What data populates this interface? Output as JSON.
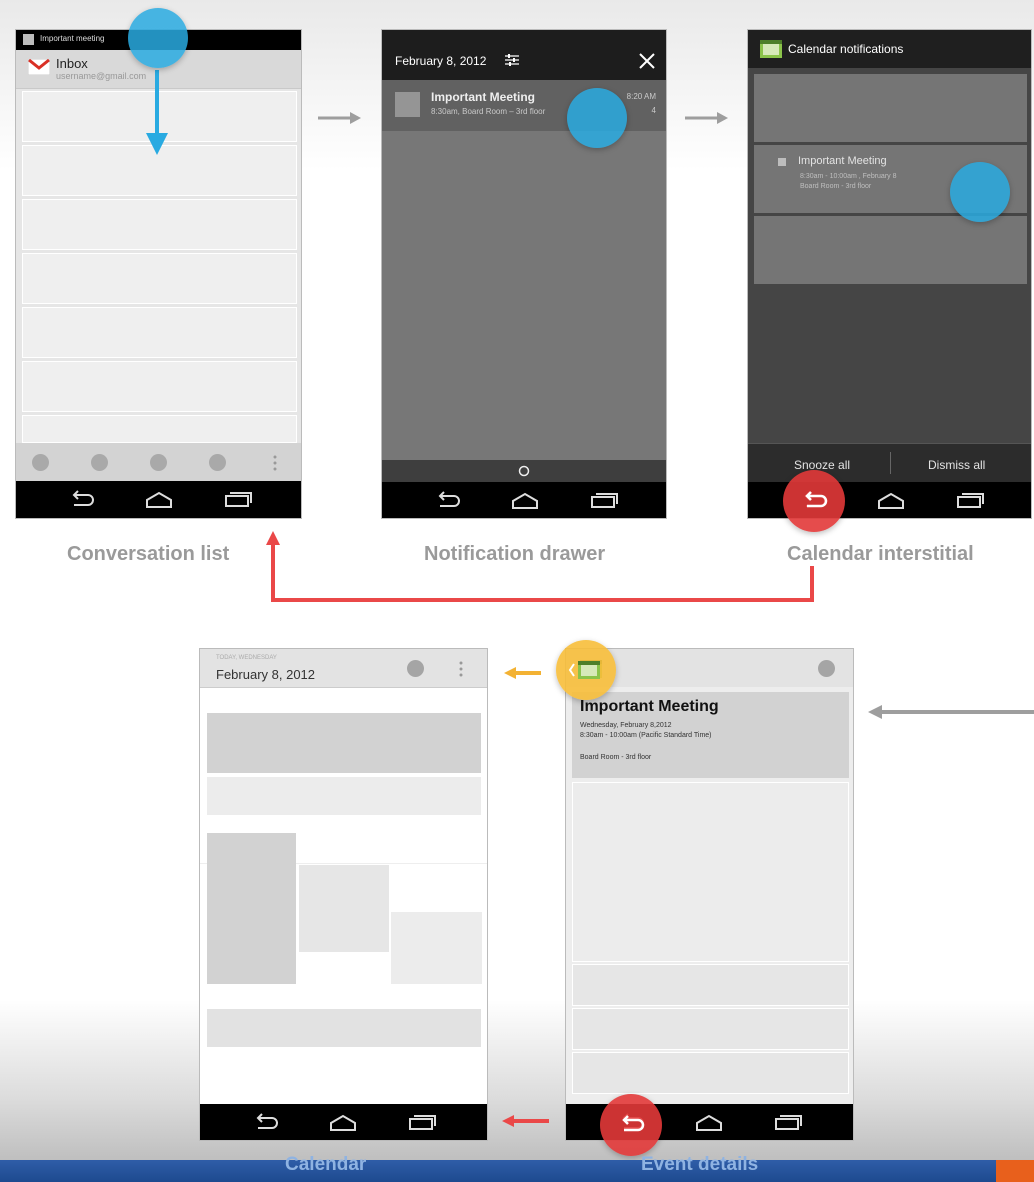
{
  "captions": {
    "conversation_list": "Conversation list",
    "notification_drawer": "Notification drawer",
    "calendar_interstitial": "Calendar interstitial",
    "calendar": "Calendar",
    "event_details": "Event details"
  },
  "gmail": {
    "notification_title": "Important meeting",
    "inbox_title": "Inbox",
    "account": "username@gmail.com"
  },
  "drawer": {
    "date": "February 8, 2012",
    "notif_title": "Important Meeting",
    "notif_subtitle": "8:30am, Board Room – 3rd floor",
    "notif_time": "8:20 AM",
    "notif_count": "4"
  },
  "interstitial": {
    "title": "Calendar notifications",
    "event_title": "Important Meeting",
    "event_line1": "8:30am - 10:00am , February 8",
    "event_line2": "Board Room - 3rd floor",
    "snooze_label": "Snooze all",
    "dismiss_label": "Dismiss all"
  },
  "calendar": {
    "day_label": "TODAY, WEDNESDAY",
    "date": "February 8, 2012"
  },
  "event": {
    "title": "Important Meeting",
    "date_line": "Wednesday, February 8,2012",
    "time_line": "8:30am - 10:00am (Pacific Standard Time)",
    "location": "Board Room - 3rd floor"
  },
  "colors": {
    "touch": "#29aae1",
    "back": "#e23838",
    "up": "#f7be3a",
    "flow_arrow": "#9e9e9e",
    "back_arrow": "#ea4848",
    "up_arrow": "#f3b233"
  }
}
